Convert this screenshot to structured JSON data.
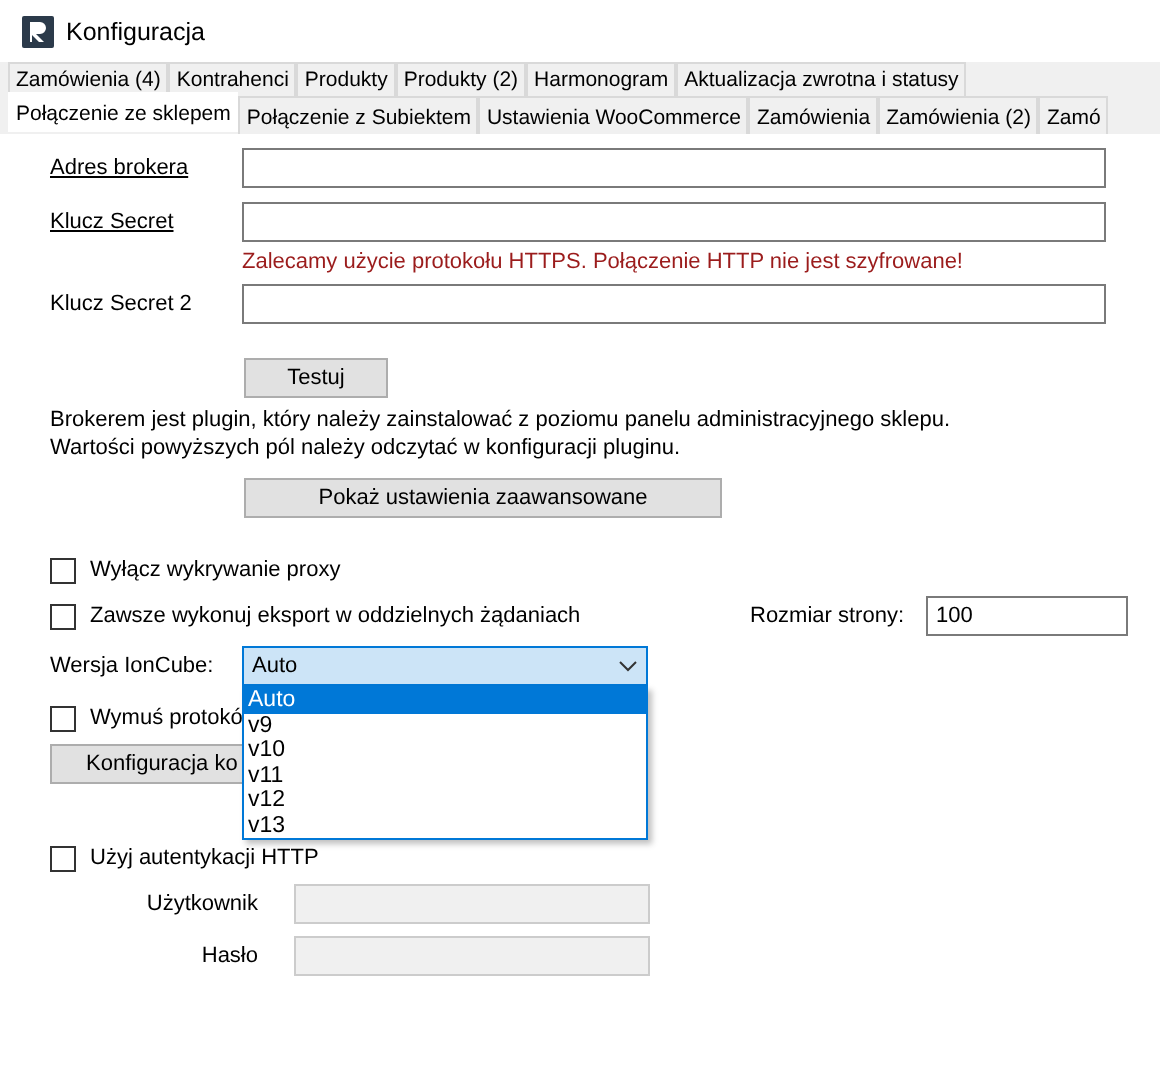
{
  "window": {
    "title": "Konfiguracja"
  },
  "tab_rows": [
    [
      {
        "label": "Zamówienia (4)",
        "selected": false
      },
      {
        "label": "Kontrahenci",
        "selected": false
      },
      {
        "label": "Produkty",
        "selected": false
      },
      {
        "label": "Produkty (2)",
        "selected": false
      },
      {
        "label": "Harmonogram",
        "selected": false
      },
      {
        "label": "Aktualizacja zwrotna i statusy",
        "selected": false
      }
    ],
    [
      {
        "label": "Połączenie ze sklepem",
        "selected": true
      },
      {
        "label": "Połączenie z Subiektem",
        "selected": false
      },
      {
        "label": "Ustawienia WooCommerce",
        "selected": false
      },
      {
        "label": "Zamówienia",
        "selected": false
      },
      {
        "label": "Zamówienia (2)",
        "selected": false
      },
      {
        "label": "Zamó",
        "selected": false
      }
    ]
  ],
  "fields": [
    {
      "label": "Adres brokera",
      "link": true
    },
    {
      "label": "Klucz Secret",
      "link": true
    },
    {
      "label": "Klucz Secret 2",
      "link": false
    }
  ],
  "warning": "Zalecamy użycie protokołu HTTPS. Połączenie HTTP nie jest szyfrowane!",
  "test_button": "Testuj",
  "info": [
    "Brokerem jest plugin, który należy zainstalować z poziomu panelu administracyjnego sklepu.",
    "Wartości powyższych pól należy odczytać w konfiguracji pluginu."
  ],
  "advanced_button": "Pokaż ustawienia zaawansowane",
  "checkbox_proxy": {
    "label": "Wyłącz wykrywanie proxy",
    "checked": false
  },
  "checkbox_export": {
    "label": "Zawsze wykonuj eksport w oddzielnych żądaniach",
    "checked": false
  },
  "page_size": {
    "label": "Rozmiar strony:",
    "value": "100"
  },
  "ioncube": {
    "label": "Wersja IonCube:",
    "value": "Auto",
    "expanded": true,
    "options": [
      {
        "label": "Auto",
        "selected": true
      },
      {
        "label": "v9",
        "selected": false
      },
      {
        "label": "v10",
        "selected": false
      },
      {
        "label": "v11",
        "selected": false
      },
      {
        "label": "v12",
        "selected": false
      },
      {
        "label": "v13",
        "selected": false
      }
    ]
  },
  "checkbox_protocol": {
    "label": "Wymuś protokó",
    "checked": false
  },
  "config_button": "Konfiguracja ko",
  "checkbox_auth": {
    "label": "Użyj autentykacji HTTP",
    "checked": false
  },
  "auth_fields": [
    {
      "label": "Użytkownik",
      "disabled": true
    },
    {
      "label": "Hasło",
      "disabled": true
    }
  ]
}
